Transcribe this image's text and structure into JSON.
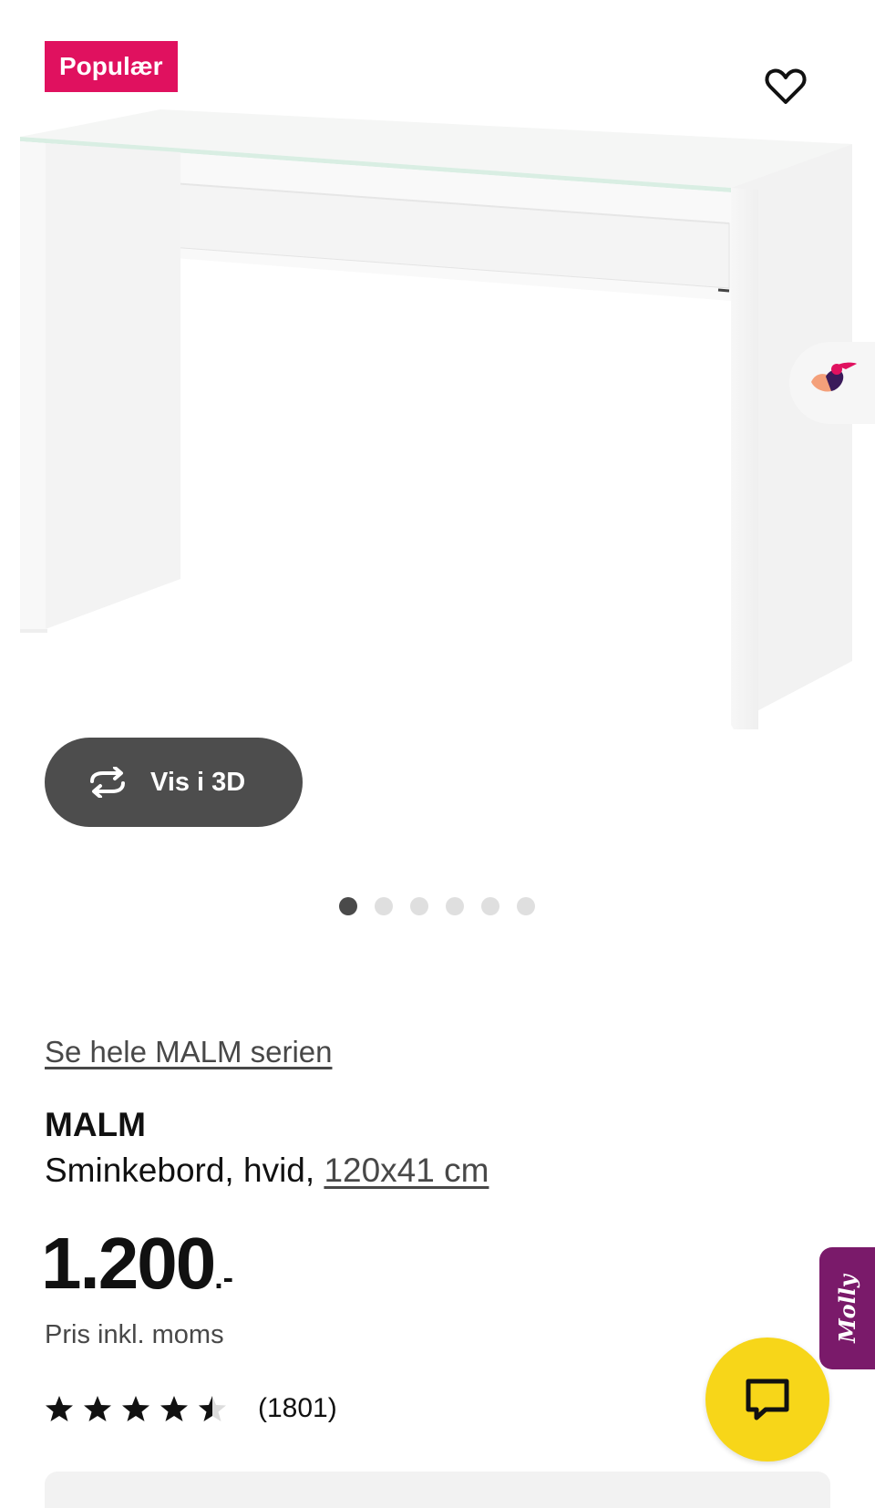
{
  "gallery": {
    "badge": "Populær",
    "favorite_icon": "heart-outline-icon",
    "view3d_label": "Vis i 3D",
    "view3d_icon": "rotate-3d-icon",
    "dots_total": 6,
    "active_dot": 1
  },
  "product": {
    "series_link": "Se hele MALM serien",
    "name": "MALM",
    "description": "Sminkebord, hvid, ",
    "dimensions": "120x41 cm",
    "price": "1.200",
    "price_suffix": ".-",
    "vat_note": "Pris inkl. moms",
    "rating": 4.5,
    "rating_max": 5,
    "review_count": "(1801)"
  },
  "assistant": {
    "tab_label": "Molly",
    "chat_icon": "chat-bubble-icon"
  },
  "colors": {
    "badge": "#e0115f",
    "button_dark": "#4d4d4d",
    "chat_yellow": "#f7d619",
    "molly_purple": "#7a1a6a"
  }
}
